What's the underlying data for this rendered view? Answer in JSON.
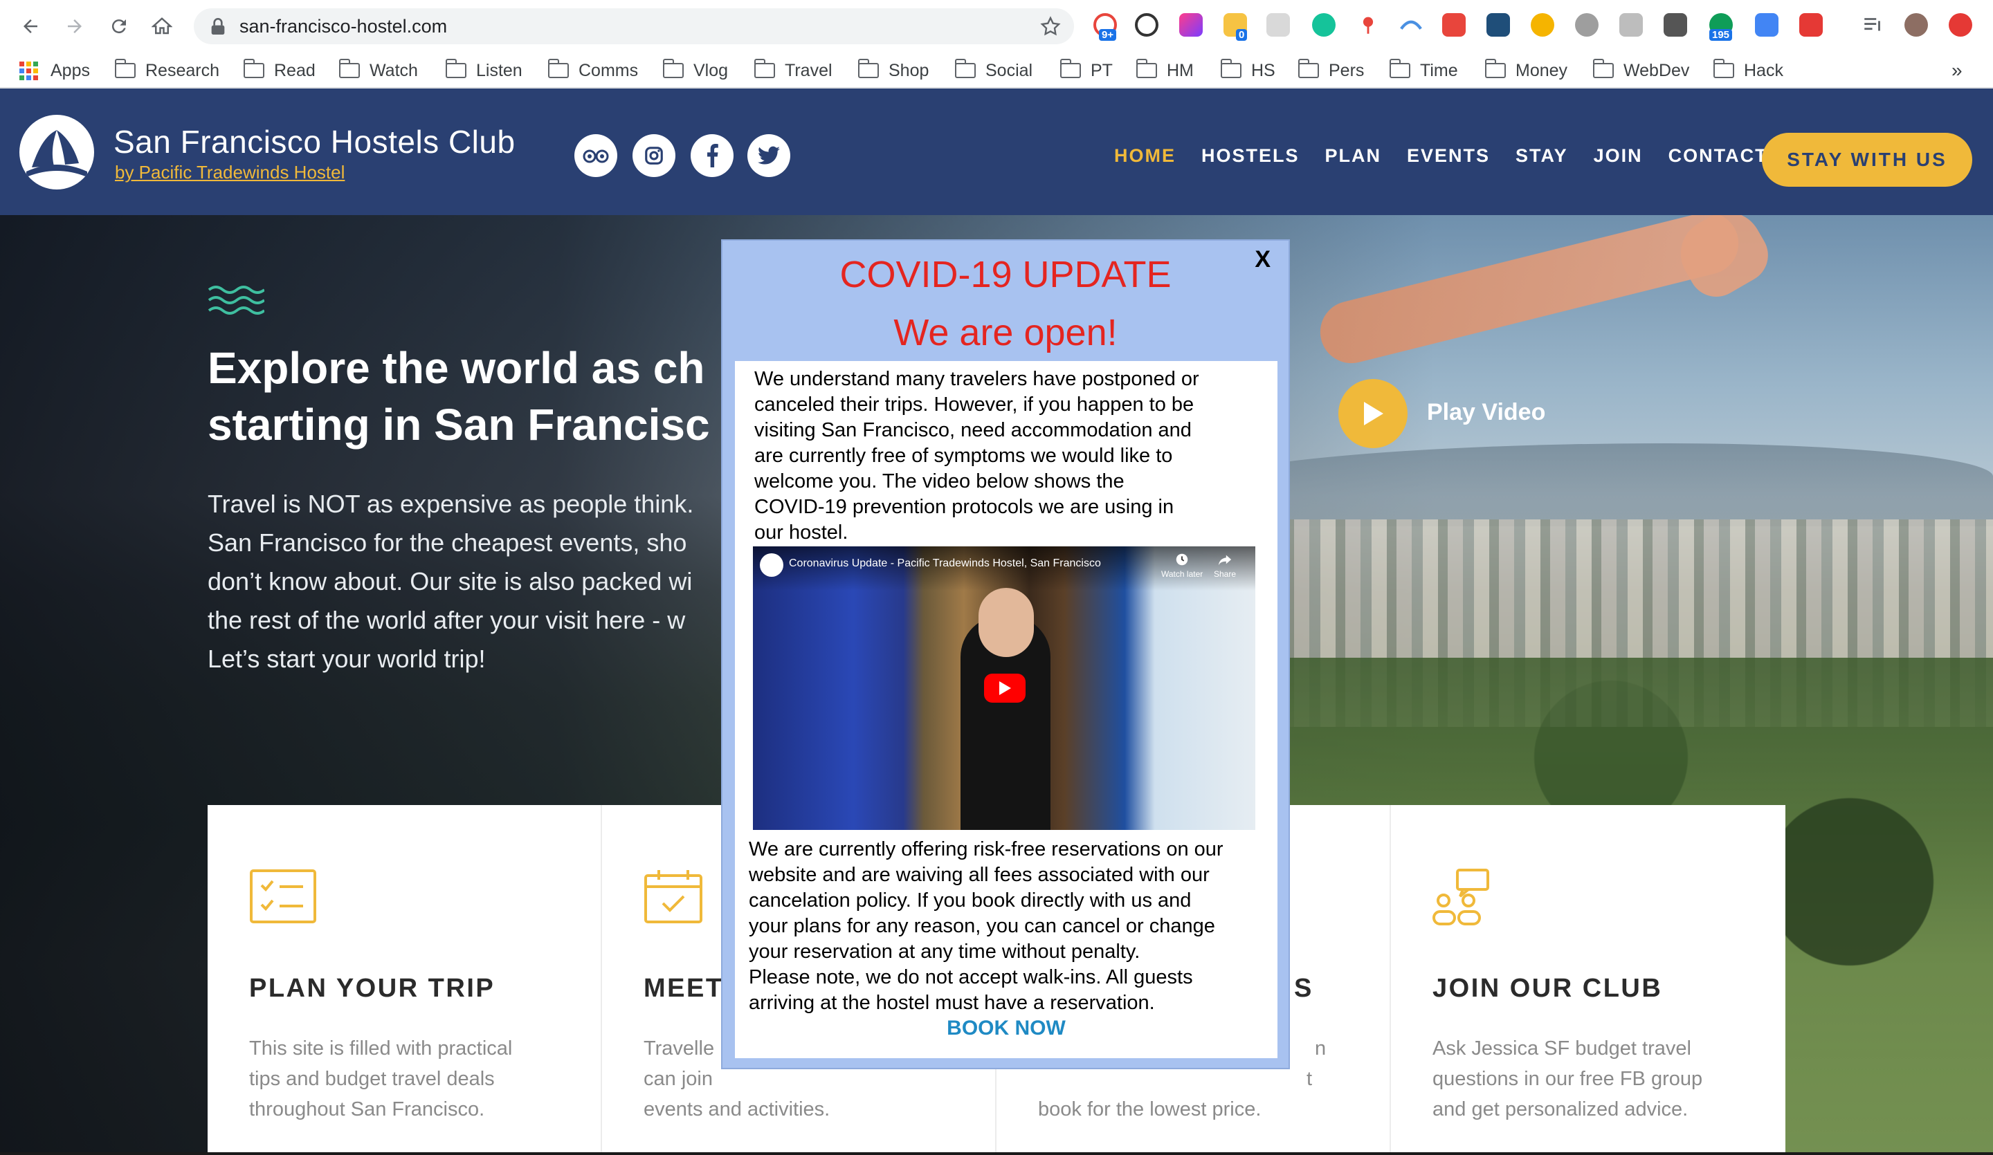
{
  "browser": {
    "url": "san-francisco-hostel.com",
    "extension_badges": {
      "first": "9+",
      "second": "0",
      "third": "195"
    },
    "bookmarks": [
      {
        "label": "Apps"
      },
      {
        "label": "Research"
      },
      {
        "label": "Read"
      },
      {
        "label": "Watch"
      },
      {
        "label": "Listen"
      },
      {
        "label": "Comms"
      },
      {
        "label": "Vlog"
      },
      {
        "label": "Travel"
      },
      {
        "label": "Shop"
      },
      {
        "label": "Social"
      },
      {
        "label": "PT"
      },
      {
        "label": "HM"
      },
      {
        "label": "HS"
      },
      {
        "label": "Pers"
      },
      {
        "label": "Time"
      },
      {
        "label": "Money"
      },
      {
        "label": "WebDev"
      },
      {
        "label": "Hack"
      }
    ],
    "overflow_label": "»"
  },
  "header": {
    "title": "San Francisco Hostels Club",
    "subtitle": "by Pacific Tradewinds Hostel",
    "nav": [
      {
        "label": "HOME",
        "active": true
      },
      {
        "label": "HOSTELS"
      },
      {
        "label": "PLAN"
      },
      {
        "label": "EVENTS"
      },
      {
        "label": "STAY"
      },
      {
        "label": "JOIN"
      },
      {
        "label": "CONTACT"
      }
    ],
    "cta": "STAY WITH US",
    "colors": {
      "bg": "#2a4072",
      "accent": "#f0b93a"
    }
  },
  "hero": {
    "title_lines": [
      "Explore the world as ch",
      "starting in San Francisc"
    ],
    "text_lines": [
      "Travel is NOT as expensive as people think.",
      "San Francisco for the cheapest events, sho",
      "don’t know about. Our site is also packed wi",
      "the rest of the world after your visit here - w",
      "Let’s start your world trip!"
    ],
    "play_label": "Play Video"
  },
  "cards": [
    {
      "title": "PLAN YOUR TRIP",
      "text_lines": [
        "This site is filled with practical",
        "tips and budget travel deals",
        "throughout San Francisco."
      ]
    },
    {
      "title": "MEET",
      "text_lines": [
        "Travelle",
        "can join",
        "events and activities."
      ]
    },
    {
      "title": "S",
      "text_lines": [
        "n",
        "t",
        "book for the lowest price."
      ]
    },
    {
      "title": "JOIN OUR CLUB",
      "text_lines": [
        "Ask Jessica SF budget travel",
        "questions in our free FB group",
        "and get personalized advice."
      ]
    }
  ],
  "modal": {
    "close": "X",
    "heading": "COVID-19 UPDATE",
    "subheading": "We are open!",
    "p1_lines": [
      "We understand many travelers have postponed or",
      "canceled their trips.  However, if you happen to be",
      "visiting San Francisco, need accommodation and",
      "are currently free of symptoms we would like to",
      "welcome you.  The video below shows the",
      "COVID-19 prevention protocols we are using in",
      "our hostel."
    ],
    "video": {
      "title": "Coronavirus Update - Pacific Tradewinds Hostel, San Francisco",
      "watch_later": "Watch later",
      "share": "Share"
    },
    "p2_lines": [
      "We are currently offering risk-free reservations on our",
      "website and are waiving all fees associated with our",
      "cancelation policy.  If you book directly with us and",
      "your plans for any reason, you can cancel or change",
      "your reservation at any time without penalty.",
      "Please note, we do not accept walk-ins.  All guests",
      "arriving at the hostel must have a reservation."
    ],
    "cta": "BOOK NOW",
    "colors": {
      "heading": "#e42520",
      "frame": "#a8c2f0",
      "link": "#1f8ac4"
    }
  }
}
